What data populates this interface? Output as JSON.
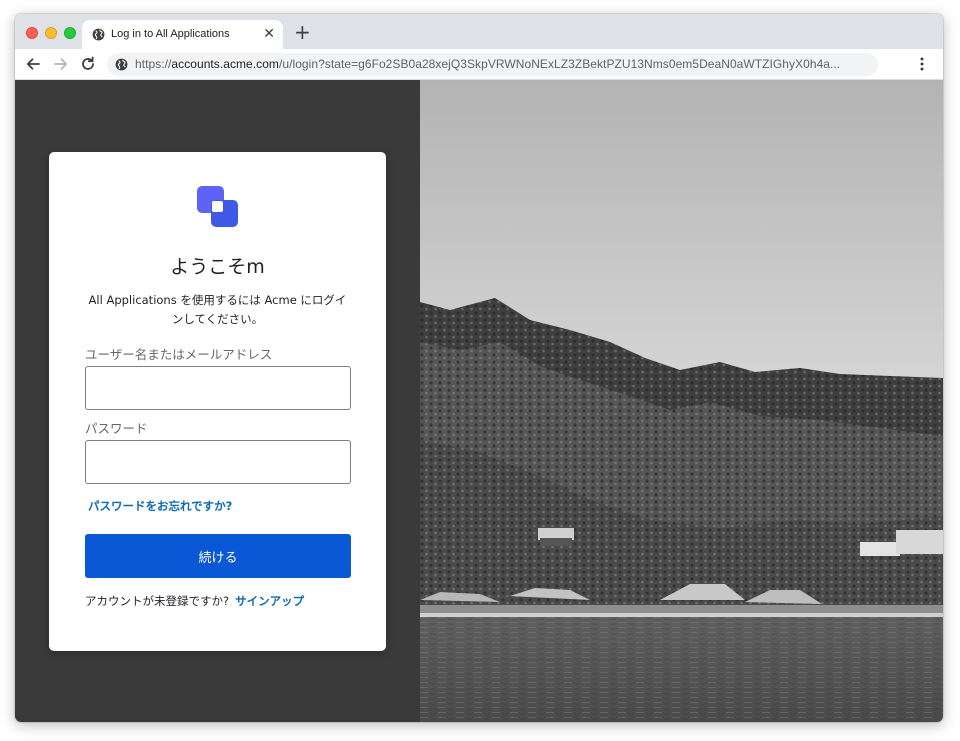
{
  "browser": {
    "tab_title": "Log in to All Applications",
    "tab_close": "✕",
    "new_tab": "+",
    "url_scheme": "https://",
    "url_host": "accounts.acme.com",
    "url_rest": "/u/login?state=g6Fo2SB0a28xejQ3SkpVRWNoNExLZ3ZBektPZU13Nms0em5DeaN0aWTZIGhyX0h4a..."
  },
  "login": {
    "welcome": "ようこそm",
    "description": "All Applications を使用するには Acme にログインしてください。",
    "username_label": "ユーザー名またはメールアドレス",
    "username_value": "",
    "password_label": "パスワード",
    "password_value": "",
    "forgot_link": "パスワードをお忘れですか?",
    "continue_button": "続ける",
    "no_account_text": "アカウントが未登録ですか?",
    "signup_link": "サインアップ"
  },
  "icons": {
    "tab": "globe-icon",
    "back": "back-arrow-icon",
    "forward": "forward-arrow-icon",
    "reload": "reload-icon",
    "site_info": "globe-icon",
    "menu": "more-vertical-icon",
    "logo": "acme-logo-icon"
  },
  "colors": {
    "accent": "#0a58d6",
    "link": "#0a6bb3",
    "logo_primary": "#5e63f5",
    "logo_secondary": "#3f59e4",
    "panel_background": "#3a3a3a"
  }
}
